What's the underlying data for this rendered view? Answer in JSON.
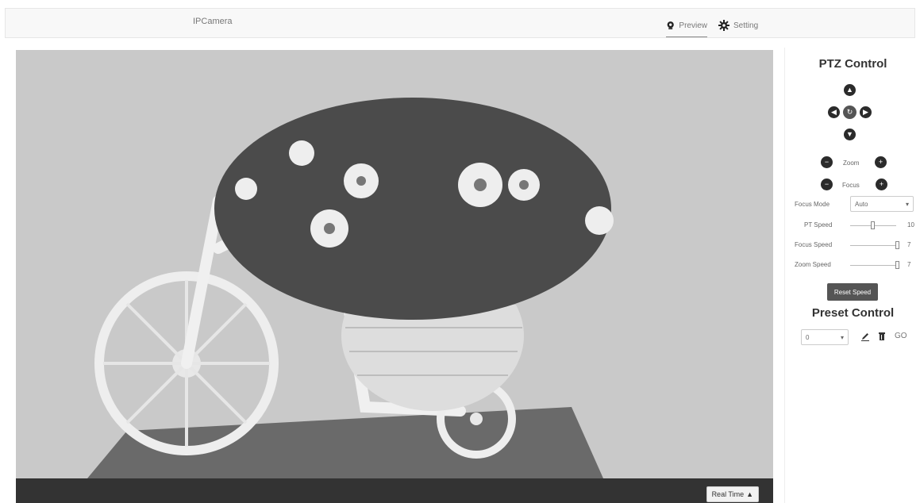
{
  "header": {
    "brand": "IPCamera",
    "nav": [
      {
        "label": "Preview",
        "icon": "camera-icon",
        "active": true
      },
      {
        "label": "Setting",
        "icon": "gear-icon",
        "active": false
      }
    ]
  },
  "video": {
    "realtime_label": "Real Time",
    "realtime_caret": "▲"
  },
  "ptz": {
    "title": "PTZ Control",
    "zoom_label": "Zoom",
    "focus_label": "Focus",
    "focus_mode_label": "Focus Mode",
    "focus_mode_value": "Auto",
    "pt_speed_label": "PT Speed",
    "pt_speed_value": "10",
    "focus_speed_label": "Focus Speed",
    "focus_speed_value": "7",
    "zoom_speed_label": "Zoom Speed",
    "zoom_speed_value": "7",
    "reset_speed_label": "Reset Speed"
  },
  "preset": {
    "title": "Preset Control",
    "selected": "0",
    "go_label": "GO"
  },
  "colors": {
    "accent_dark": "#2b2b2b",
    "button_gray": "#555555"
  }
}
